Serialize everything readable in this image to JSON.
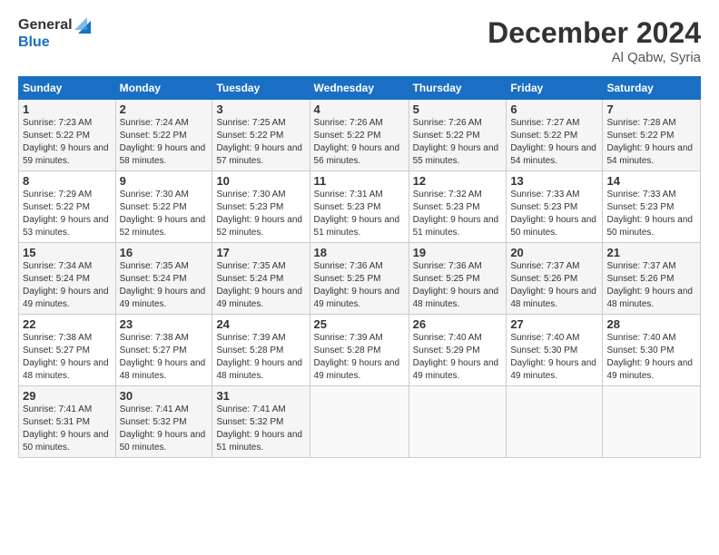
{
  "logo": {
    "line1": "General",
    "line2": "Blue"
  },
  "title": "December 2024",
  "location": "Al Qabw, Syria",
  "weekdays": [
    "Sunday",
    "Monday",
    "Tuesday",
    "Wednesday",
    "Thursday",
    "Friday",
    "Saturday"
  ],
  "weeks": [
    [
      {
        "day": "1",
        "sunrise": "Sunrise: 7:23 AM",
        "sunset": "Sunset: 5:22 PM",
        "daylight": "Daylight: 9 hours and 59 minutes."
      },
      {
        "day": "2",
        "sunrise": "Sunrise: 7:24 AM",
        "sunset": "Sunset: 5:22 PM",
        "daylight": "Daylight: 9 hours and 58 minutes."
      },
      {
        "day": "3",
        "sunrise": "Sunrise: 7:25 AM",
        "sunset": "Sunset: 5:22 PM",
        "daylight": "Daylight: 9 hours and 57 minutes."
      },
      {
        "day": "4",
        "sunrise": "Sunrise: 7:26 AM",
        "sunset": "Sunset: 5:22 PM",
        "daylight": "Daylight: 9 hours and 56 minutes."
      },
      {
        "day": "5",
        "sunrise": "Sunrise: 7:26 AM",
        "sunset": "Sunset: 5:22 PM",
        "daylight": "Daylight: 9 hours and 55 minutes."
      },
      {
        "day": "6",
        "sunrise": "Sunrise: 7:27 AM",
        "sunset": "Sunset: 5:22 PM",
        "daylight": "Daylight: 9 hours and 54 minutes."
      },
      {
        "day": "7",
        "sunrise": "Sunrise: 7:28 AM",
        "sunset": "Sunset: 5:22 PM",
        "daylight": "Daylight: 9 hours and 54 minutes."
      }
    ],
    [
      {
        "day": "8",
        "sunrise": "Sunrise: 7:29 AM",
        "sunset": "Sunset: 5:22 PM",
        "daylight": "Daylight: 9 hours and 53 minutes."
      },
      {
        "day": "9",
        "sunrise": "Sunrise: 7:30 AM",
        "sunset": "Sunset: 5:22 PM",
        "daylight": "Daylight: 9 hours and 52 minutes."
      },
      {
        "day": "10",
        "sunrise": "Sunrise: 7:30 AM",
        "sunset": "Sunset: 5:23 PM",
        "daylight": "Daylight: 9 hours and 52 minutes."
      },
      {
        "day": "11",
        "sunrise": "Sunrise: 7:31 AM",
        "sunset": "Sunset: 5:23 PM",
        "daylight": "Daylight: 9 hours and 51 minutes."
      },
      {
        "day": "12",
        "sunrise": "Sunrise: 7:32 AM",
        "sunset": "Sunset: 5:23 PM",
        "daylight": "Daylight: 9 hours and 51 minutes."
      },
      {
        "day": "13",
        "sunrise": "Sunrise: 7:33 AM",
        "sunset": "Sunset: 5:23 PM",
        "daylight": "Daylight: 9 hours and 50 minutes."
      },
      {
        "day": "14",
        "sunrise": "Sunrise: 7:33 AM",
        "sunset": "Sunset: 5:23 PM",
        "daylight": "Daylight: 9 hours and 50 minutes."
      }
    ],
    [
      {
        "day": "15",
        "sunrise": "Sunrise: 7:34 AM",
        "sunset": "Sunset: 5:24 PM",
        "daylight": "Daylight: 9 hours and 49 minutes."
      },
      {
        "day": "16",
        "sunrise": "Sunrise: 7:35 AM",
        "sunset": "Sunset: 5:24 PM",
        "daylight": "Daylight: 9 hours and 49 minutes."
      },
      {
        "day": "17",
        "sunrise": "Sunrise: 7:35 AM",
        "sunset": "Sunset: 5:24 PM",
        "daylight": "Daylight: 9 hours and 49 minutes."
      },
      {
        "day": "18",
        "sunrise": "Sunrise: 7:36 AM",
        "sunset": "Sunset: 5:25 PM",
        "daylight": "Daylight: 9 hours and 49 minutes."
      },
      {
        "day": "19",
        "sunrise": "Sunrise: 7:36 AM",
        "sunset": "Sunset: 5:25 PM",
        "daylight": "Daylight: 9 hours and 48 minutes."
      },
      {
        "day": "20",
        "sunrise": "Sunrise: 7:37 AM",
        "sunset": "Sunset: 5:26 PM",
        "daylight": "Daylight: 9 hours and 48 minutes."
      },
      {
        "day": "21",
        "sunrise": "Sunrise: 7:37 AM",
        "sunset": "Sunset: 5:26 PM",
        "daylight": "Daylight: 9 hours and 48 minutes."
      }
    ],
    [
      {
        "day": "22",
        "sunrise": "Sunrise: 7:38 AM",
        "sunset": "Sunset: 5:27 PM",
        "daylight": "Daylight: 9 hours and 48 minutes."
      },
      {
        "day": "23",
        "sunrise": "Sunrise: 7:38 AM",
        "sunset": "Sunset: 5:27 PM",
        "daylight": "Daylight: 9 hours and 48 minutes."
      },
      {
        "day": "24",
        "sunrise": "Sunrise: 7:39 AM",
        "sunset": "Sunset: 5:28 PM",
        "daylight": "Daylight: 9 hours and 48 minutes."
      },
      {
        "day": "25",
        "sunrise": "Sunrise: 7:39 AM",
        "sunset": "Sunset: 5:28 PM",
        "daylight": "Daylight: 9 hours and 49 minutes."
      },
      {
        "day": "26",
        "sunrise": "Sunrise: 7:40 AM",
        "sunset": "Sunset: 5:29 PM",
        "daylight": "Daylight: 9 hours and 49 minutes."
      },
      {
        "day": "27",
        "sunrise": "Sunrise: 7:40 AM",
        "sunset": "Sunset: 5:30 PM",
        "daylight": "Daylight: 9 hours and 49 minutes."
      },
      {
        "day": "28",
        "sunrise": "Sunrise: 7:40 AM",
        "sunset": "Sunset: 5:30 PM",
        "daylight": "Daylight: 9 hours and 49 minutes."
      }
    ],
    [
      {
        "day": "29",
        "sunrise": "Sunrise: 7:41 AM",
        "sunset": "Sunset: 5:31 PM",
        "daylight": "Daylight: 9 hours and 50 minutes."
      },
      {
        "day": "30",
        "sunrise": "Sunrise: 7:41 AM",
        "sunset": "Sunset: 5:32 PM",
        "daylight": "Daylight: 9 hours and 50 minutes."
      },
      {
        "day": "31",
        "sunrise": "Sunrise: 7:41 AM",
        "sunset": "Sunset: 5:32 PM",
        "daylight": "Daylight: 9 hours and 51 minutes."
      },
      null,
      null,
      null,
      null
    ]
  ]
}
